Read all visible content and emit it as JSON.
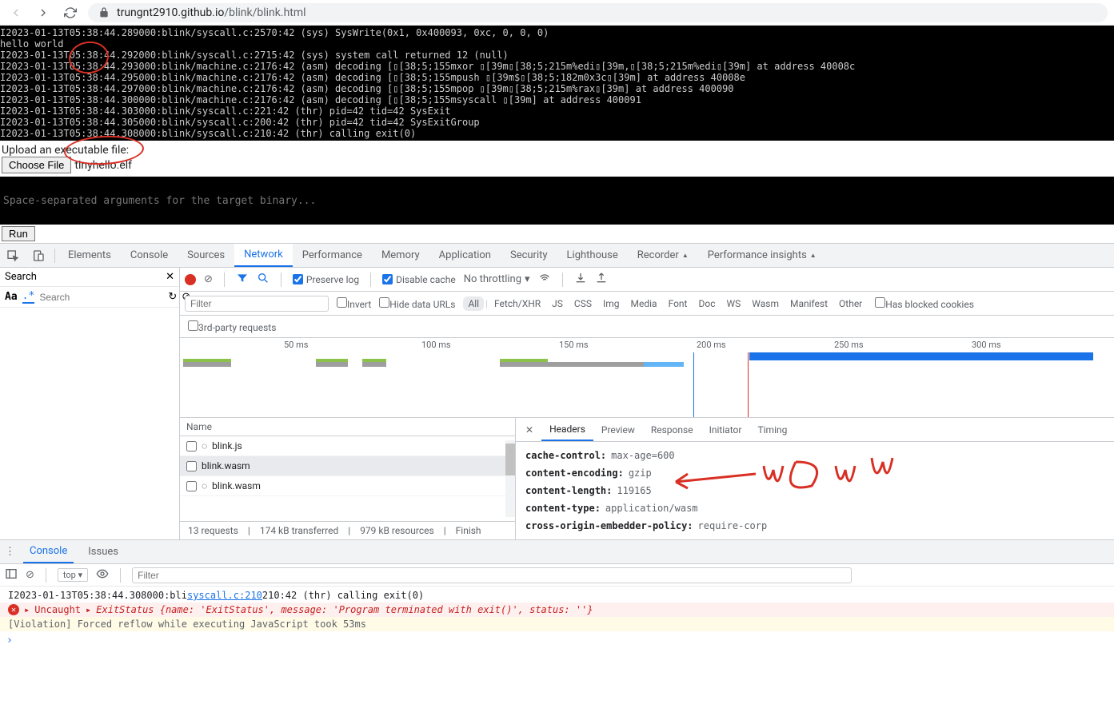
{
  "url": {
    "host": "trungnt2910.github.io",
    "path": "/blink/blink.html"
  },
  "terminal_lines": [
    "I2023-01-13T05:38:44.289000:blink/syscall.c:2570:42 (sys) SysWrite(0x1, 0x400093, 0xc, 0, 0, 0)",
    "hello world",
    "I2023-01-13T05:38:44.292000:blink/syscall.c:2715:42 (sys) system call returned 12 (null)",
    "I2023-01-13T05:38:44.293000:blink/machine.c:2176:42 (asm) decoding [▯[38;5;155mxor ▯[39m▯[38;5;215m%edi▯[39m,▯[38;5;215m%edi▯[39m] at address 40008c",
    "I2023-01-13T05:38:44.295000:blink/machine.c:2176:42 (asm) decoding [▯[38;5;155mpush ▯[39m$▯[38;5;182m0x3c▯[39m] at address 40008e",
    "I2023-01-13T05:38:44.297000:blink/machine.c:2176:42 (asm) decoding [▯[38;5;155mpop ▯[39m▯[38;5;215m%rax▯[39m] at address 400090",
    "I2023-01-13T05:38:44.300000:blink/machine.c:2176:42 (asm) decoding [▯[38;5;155msyscall ▯[39m] at address 400091",
    "I2023-01-13T05:38:44.303000:blink/syscall.c:221:42 (thr) pid=42 tid=42 SysExit",
    "I2023-01-13T05:38:44.305000:blink/syscall.c:200:42 (thr) pid=42 tid=42 SysExitGroup",
    "I2023-01-13T05:38:44.308000:blink/syscall.c:210:42 (thr) calling exit(0)"
  ],
  "upload": {
    "label": "Upload an executable file:",
    "button": "Choose File",
    "filename": "tinyhello.elf"
  },
  "args_placeholder": "Space-separated arguments for the target binary...",
  "run_label": "Run",
  "devtools": {
    "tabs": [
      "Elements",
      "Console",
      "Sources",
      "Network",
      "Performance",
      "Memory",
      "Application",
      "Security",
      "Lighthouse",
      "Recorder",
      "Performance insights"
    ],
    "active_tab": "Network",
    "search_label": "Search",
    "search_placeholder": "Search",
    "aa_label": "Aa",
    "regex_label": ".*",
    "preserve_log": "Preserve log",
    "disable_cache": "Disable cache",
    "throttling": "No throttling",
    "filter_placeholder": "Filter",
    "invert": "Invert",
    "hide_data_urls": "Hide data URLs",
    "type_filters": [
      "All",
      "Fetch/XHR",
      "JS",
      "CSS",
      "Img",
      "Media",
      "Font",
      "Doc",
      "WS",
      "Wasm",
      "Manifest",
      "Other"
    ],
    "blocked_cookies": "Has blocked cookies",
    "third_party": "3rd-party requests",
    "waterfall_ticks": [
      "50 ms",
      "100 ms",
      "150 ms",
      "200 ms",
      "250 ms",
      "300 ms"
    ],
    "name_header": "Name",
    "requests": [
      {
        "name": "blink.js",
        "icon": "loading"
      },
      {
        "name": "blink.wasm",
        "icon": "none",
        "selected": true
      },
      {
        "name": "blink.wasm",
        "icon": "loading"
      }
    ],
    "status_bar": {
      "requests": "13 requests",
      "transferred": "174 kB transferred",
      "resources": "979 kB resources",
      "finish": "Finish"
    },
    "headers_tabs": [
      "Headers",
      "Preview",
      "Response",
      "Initiator",
      "Timing"
    ],
    "response_headers": [
      {
        "name": "cache-control:",
        "value": "max-age=600"
      },
      {
        "name": "content-encoding:",
        "value": "gzip"
      },
      {
        "name": "content-length:",
        "value": "119165"
      },
      {
        "name": "content-type:",
        "value": "application/wasm"
      },
      {
        "name": "cross-origin-embedder-policy:",
        "value": "require-corp"
      }
    ]
  },
  "drawer": {
    "tabs": [
      "Console",
      "Issues"
    ],
    "top_label": "top",
    "filter_placeholder": "Filter",
    "lines": [
      {
        "type": "log",
        "text": "I2023-01-13T05:38:44.308000:blink/syscall.c:210:42 (thr) calling exit(0)",
        "link": "syscall.c:210"
      },
      {
        "type": "error",
        "prefix": "Uncaught",
        "detail": "ExitStatus {name: 'ExitStatus', message: 'Program terminated with exit()', status: ''}"
      },
      {
        "type": "warn",
        "text": "[Violation] Forced reflow while executing JavaScript took 53ms"
      }
    ]
  },
  "annotation": "WOW"
}
